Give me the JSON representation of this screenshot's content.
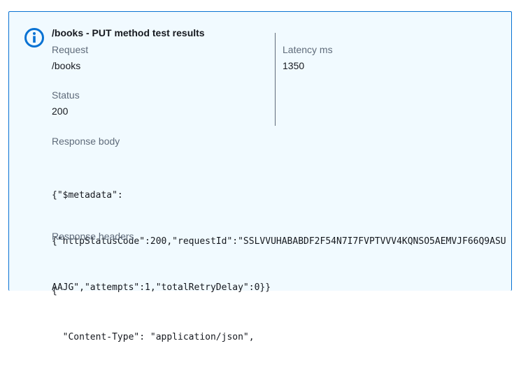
{
  "panel": {
    "title": "/books - PUT method test results",
    "icon": "info-circle-icon",
    "accent_color": "#0972d3",
    "background_color": "#f1faff"
  },
  "request": {
    "label": "Request",
    "value": "/books"
  },
  "latency": {
    "label": "Latency ms",
    "value": "1350"
  },
  "status": {
    "label": "Status",
    "value": "200"
  },
  "response_body": {
    "label": "Response body",
    "lines": [
      "{\"$metadata\":",
      "{\"httpStatusCode\":200,\"requestId\":\"SSLVVUHABABDF2F54N7I7FVPTVVV4KQNSO5AEMVJF66Q9ASU",
      "AAJG\",\"attempts\":1,\"totalRetryDelay\":0}}"
    ]
  },
  "response_headers": {
    "label": "Response headers",
    "lines": [
      "{",
      "  \"Content-Type\": \"application/json\","
    ]
  }
}
